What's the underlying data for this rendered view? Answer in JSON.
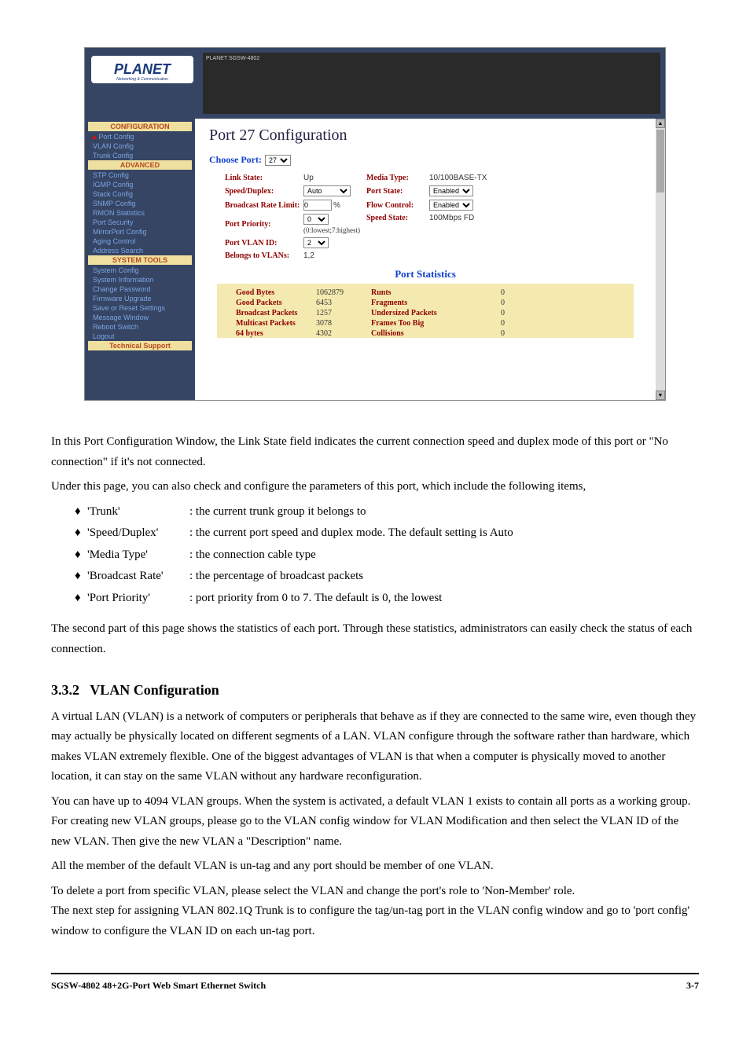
{
  "screenshot": {
    "logo": "PLANET",
    "logo_sub": "Networking & Communication",
    "switch_model": "PLANET SGSW-4802",
    "nav": {
      "configuration_header": "CONFIGURATION",
      "items_cfg": [
        "Port Config",
        "VLAN Config",
        "Trunk Config"
      ],
      "advanced_header": "ADVANCED",
      "items_adv": [
        "STP Config",
        "IGMP Config",
        "Stack Config",
        "SNMP Config",
        "RMON Statistics",
        "Port Security",
        "MirrorPort Config",
        "Aging Control",
        "Address Search"
      ],
      "system_header": "SYSTEM TOOLS",
      "items_sys": [
        "System Config",
        "System Information",
        "Change Password",
        "Firmware Upgrade",
        "Save or Reset Settings",
        "Message Window",
        "Reboot Switch",
        "Logout"
      ],
      "tech_header": "Technical Support"
    },
    "page_title": "Port 27 Configuration",
    "choose_port_label": "Choose Port:",
    "choose_port_value": "27",
    "cfg": {
      "link_state_lbl": "Link State:",
      "link_state_val": "Up",
      "media_lbl": "Media Type:",
      "media_val": "10/100BASE-TX",
      "speed_lbl": "Speed/Duplex:",
      "speed_val": "Auto",
      "pstate_lbl": "Port State:",
      "pstate_val": "Enabled",
      "brate_lbl": "Broadcast Rate Limit:",
      "brate_val": "0",
      "brate_unit": "%",
      "flow_lbl": "Flow Control:",
      "flow_val": "Enabled",
      "prio_lbl": "Port Priority:",
      "prio_val": "0",
      "prio_hint": "(0:lowest;7:highest)",
      "sstate_lbl": "Speed State:",
      "sstate_val": "100Mbps FD",
      "pvid_lbl": "Port VLAN ID:",
      "pvid_val": "2",
      "belongs_lbl": "Belongs to VLANs:",
      "belongs_val": "1,2"
    },
    "stats_title": "Port Statistics",
    "stats": [
      {
        "l1": "Good Bytes",
        "v1": "1062879",
        "l2": "Runts",
        "v2": "0"
      },
      {
        "l1": "Good Packets",
        "v1": "6453",
        "l2": "Fragments",
        "v2": "0"
      },
      {
        "l1": "Broadcast Packets",
        "v1": "1257",
        "l2": "Undersized Packets",
        "v2": "0"
      },
      {
        "l1": "Multicast Packets",
        "v1": "3078",
        "l2": "Frames Too Big",
        "v2": "0"
      },
      {
        "l1": "64 bytes",
        "v1": "4302",
        "l2": "Collisions",
        "v2": "0"
      }
    ]
  },
  "doc": {
    "intro1": "In this Port Configuration Window, the Link State field indicates the current connection speed and duplex mode of this port or \"No connection\" if it's not connected.",
    "intro2_pre": "Under this page, you can also check and configure the parameters of this port, which include the following items,",
    "params": [
      {
        "term": "'Trunk'",
        "desc": ": the current trunk group it belongs to"
      },
      {
        "term": "'Speed/Duplex'",
        "desc": ": the current port speed and duplex mode. The default setting is Auto"
      },
      {
        "term": "'Media Type'",
        "desc": ": the connection cable type"
      },
      {
        "term": "'Broadcast Rate'",
        "desc": ": the percentage of broadcast packets"
      },
      {
        "term": "'Port Priority'",
        "desc": ": port priority from 0 to 7. The default is 0, the lowest"
      }
    ],
    "intro3": "The second part of this page shows the statistics of each port. Through these statistics, administrators can easily check the status of each connection.",
    "section_num": "3.3.2",
    "section_title": "VLAN Configuration",
    "vlan1": "A virtual LAN (VLAN) is a network of computers or peripherals that behave as if they are connected to the same wire, even though they may actually be physically located on different segments of a LAN. VLAN configure through the software rather than hardware, which makes VLAN extremely flexible. One of the biggest advantages of VLAN is that when a computer is physically moved to another location, it can stay on the same VLAN without any hardware reconfiguration.",
    "vlan2": "You can have up to 4094 VLAN groups. When the system is activated, a default VLAN 1 exists to contain all ports as a working group. For creating new VLAN groups, please go to the VLAN config window for VLAN Modification and then select the VLAN ID of the new VLAN. Then give the new VLAN a \"Description\" name.",
    "vlan3": "All the member of the default VLAN is un-tag and any port should be member of one VLAN.",
    "vlan4": "To delete a port from specific VLAN, please select the VLAN and change the port's role to 'Non-Member' role.\nThe next step for assigning VLAN 802.1Q Trunk is to configure the tag/un-tag port in the VLAN config window and go to 'port config' window to configure the VLAN ID on each un-tag port.",
    "footer_title": "SGSW-4802 48+2G-Port Web Smart Ethernet Switch",
    "footer_page": "3-7"
  }
}
